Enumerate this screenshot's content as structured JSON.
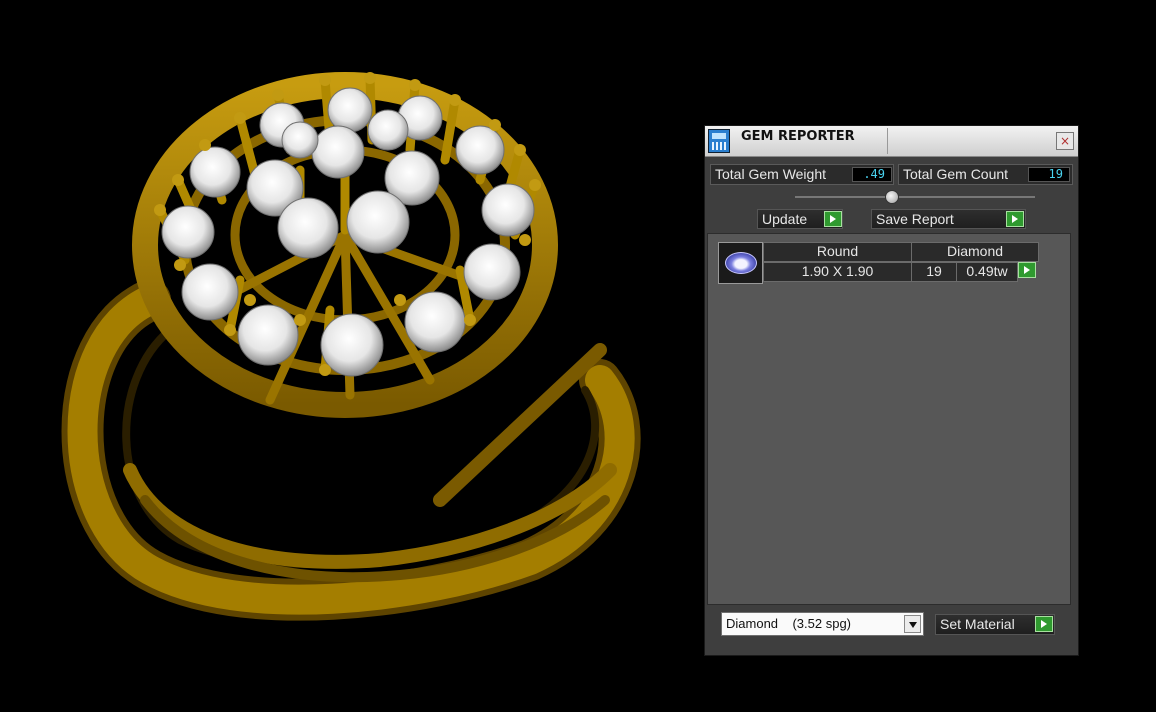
{
  "window": {
    "title": "GEM REPORTER",
    "close_glyph": "×",
    "icon": "gem-reporter-icon"
  },
  "stats": {
    "total_weight_label": "Total Gem Weight",
    "total_weight_value": ".49",
    "total_count_label": "Total Gem Count",
    "total_count_value": "19"
  },
  "actions": {
    "update_label": "Update",
    "save_report_label": "Save Report"
  },
  "gem_list": {
    "rows": [
      {
        "thumbnail": "round-gem-icon",
        "shape": "Round",
        "material": "Diamond",
        "size": "1.90 X 1.90",
        "count": "19",
        "weight": "0.49tw"
      }
    ]
  },
  "material": {
    "selected": "Diamond    (3.52 spg)",
    "set_material_label": "Set Material"
  },
  "colors": {
    "metal": "#b08900",
    "panel_bg": "#3e3e3e",
    "value_text": "#49d3f0",
    "play_green": "#2f9a2f"
  }
}
